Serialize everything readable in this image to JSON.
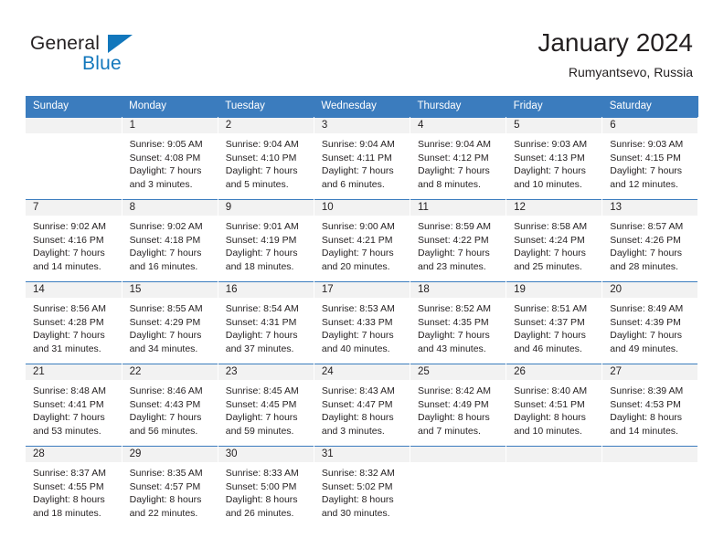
{
  "brand": {
    "name_part1": "General",
    "name_part2": "Blue"
  },
  "header": {
    "title": "January 2024",
    "subtitle": "Rumyantsevo, Russia"
  },
  "colors": {
    "header_blue": "#3b7cbe",
    "brand_blue": "#1277bc",
    "daynum_band": "#f2f2f2",
    "text": "#231f20"
  },
  "calendar": {
    "weekday_headers": [
      "Sunday",
      "Monday",
      "Tuesday",
      "Wednesday",
      "Thursday",
      "Friday",
      "Saturday"
    ],
    "weeks": [
      [
        {
          "day": "",
          "sunrise": "",
          "sunset": "",
          "daylight_line1": "",
          "daylight_line2": ""
        },
        {
          "day": "1",
          "sunrise": "Sunrise: 9:05 AM",
          "sunset": "Sunset: 4:08 PM",
          "daylight_line1": "Daylight: 7 hours",
          "daylight_line2": "and 3 minutes."
        },
        {
          "day": "2",
          "sunrise": "Sunrise: 9:04 AM",
          "sunset": "Sunset: 4:10 PM",
          "daylight_line1": "Daylight: 7 hours",
          "daylight_line2": "and 5 minutes."
        },
        {
          "day": "3",
          "sunrise": "Sunrise: 9:04 AM",
          "sunset": "Sunset: 4:11 PM",
          "daylight_line1": "Daylight: 7 hours",
          "daylight_line2": "and 6 minutes."
        },
        {
          "day": "4",
          "sunrise": "Sunrise: 9:04 AM",
          "sunset": "Sunset: 4:12 PM",
          "daylight_line1": "Daylight: 7 hours",
          "daylight_line2": "and 8 minutes."
        },
        {
          "day": "5",
          "sunrise": "Sunrise: 9:03 AM",
          "sunset": "Sunset: 4:13 PM",
          "daylight_line1": "Daylight: 7 hours",
          "daylight_line2": "and 10 minutes."
        },
        {
          "day": "6",
          "sunrise": "Sunrise: 9:03 AM",
          "sunset": "Sunset: 4:15 PM",
          "daylight_line1": "Daylight: 7 hours",
          "daylight_line2": "and 12 minutes."
        }
      ],
      [
        {
          "day": "7",
          "sunrise": "Sunrise: 9:02 AM",
          "sunset": "Sunset: 4:16 PM",
          "daylight_line1": "Daylight: 7 hours",
          "daylight_line2": "and 14 minutes."
        },
        {
          "day": "8",
          "sunrise": "Sunrise: 9:02 AM",
          "sunset": "Sunset: 4:18 PM",
          "daylight_line1": "Daylight: 7 hours",
          "daylight_line2": "and 16 minutes."
        },
        {
          "day": "9",
          "sunrise": "Sunrise: 9:01 AM",
          "sunset": "Sunset: 4:19 PM",
          "daylight_line1": "Daylight: 7 hours",
          "daylight_line2": "and 18 minutes."
        },
        {
          "day": "10",
          "sunrise": "Sunrise: 9:00 AM",
          "sunset": "Sunset: 4:21 PM",
          "daylight_line1": "Daylight: 7 hours",
          "daylight_line2": "and 20 minutes."
        },
        {
          "day": "11",
          "sunrise": "Sunrise: 8:59 AM",
          "sunset": "Sunset: 4:22 PM",
          "daylight_line1": "Daylight: 7 hours",
          "daylight_line2": "and 23 minutes."
        },
        {
          "day": "12",
          "sunrise": "Sunrise: 8:58 AM",
          "sunset": "Sunset: 4:24 PM",
          "daylight_line1": "Daylight: 7 hours",
          "daylight_line2": "and 25 minutes."
        },
        {
          "day": "13",
          "sunrise": "Sunrise: 8:57 AM",
          "sunset": "Sunset: 4:26 PM",
          "daylight_line1": "Daylight: 7 hours",
          "daylight_line2": "and 28 minutes."
        }
      ],
      [
        {
          "day": "14",
          "sunrise": "Sunrise: 8:56 AM",
          "sunset": "Sunset: 4:28 PM",
          "daylight_line1": "Daylight: 7 hours",
          "daylight_line2": "and 31 minutes."
        },
        {
          "day": "15",
          "sunrise": "Sunrise: 8:55 AM",
          "sunset": "Sunset: 4:29 PM",
          "daylight_line1": "Daylight: 7 hours",
          "daylight_line2": "and 34 minutes."
        },
        {
          "day": "16",
          "sunrise": "Sunrise: 8:54 AM",
          "sunset": "Sunset: 4:31 PM",
          "daylight_line1": "Daylight: 7 hours",
          "daylight_line2": "and 37 minutes."
        },
        {
          "day": "17",
          "sunrise": "Sunrise: 8:53 AM",
          "sunset": "Sunset: 4:33 PM",
          "daylight_line1": "Daylight: 7 hours",
          "daylight_line2": "and 40 minutes."
        },
        {
          "day": "18",
          "sunrise": "Sunrise: 8:52 AM",
          "sunset": "Sunset: 4:35 PM",
          "daylight_line1": "Daylight: 7 hours",
          "daylight_line2": "and 43 minutes."
        },
        {
          "day": "19",
          "sunrise": "Sunrise: 8:51 AM",
          "sunset": "Sunset: 4:37 PM",
          "daylight_line1": "Daylight: 7 hours",
          "daylight_line2": "and 46 minutes."
        },
        {
          "day": "20",
          "sunrise": "Sunrise: 8:49 AM",
          "sunset": "Sunset: 4:39 PM",
          "daylight_line1": "Daylight: 7 hours",
          "daylight_line2": "and 49 minutes."
        }
      ],
      [
        {
          "day": "21",
          "sunrise": "Sunrise: 8:48 AM",
          "sunset": "Sunset: 4:41 PM",
          "daylight_line1": "Daylight: 7 hours",
          "daylight_line2": "and 53 minutes."
        },
        {
          "day": "22",
          "sunrise": "Sunrise: 8:46 AM",
          "sunset": "Sunset: 4:43 PM",
          "daylight_line1": "Daylight: 7 hours",
          "daylight_line2": "and 56 minutes."
        },
        {
          "day": "23",
          "sunrise": "Sunrise: 8:45 AM",
          "sunset": "Sunset: 4:45 PM",
          "daylight_line1": "Daylight: 7 hours",
          "daylight_line2": "and 59 minutes."
        },
        {
          "day": "24",
          "sunrise": "Sunrise: 8:43 AM",
          "sunset": "Sunset: 4:47 PM",
          "daylight_line1": "Daylight: 8 hours",
          "daylight_line2": "and 3 minutes."
        },
        {
          "day": "25",
          "sunrise": "Sunrise: 8:42 AM",
          "sunset": "Sunset: 4:49 PM",
          "daylight_line1": "Daylight: 8 hours",
          "daylight_line2": "and 7 minutes."
        },
        {
          "day": "26",
          "sunrise": "Sunrise: 8:40 AM",
          "sunset": "Sunset: 4:51 PM",
          "daylight_line1": "Daylight: 8 hours",
          "daylight_line2": "and 10 minutes."
        },
        {
          "day": "27",
          "sunrise": "Sunrise: 8:39 AM",
          "sunset": "Sunset: 4:53 PM",
          "daylight_line1": "Daylight: 8 hours",
          "daylight_line2": "and 14 minutes."
        }
      ],
      [
        {
          "day": "28",
          "sunrise": "Sunrise: 8:37 AM",
          "sunset": "Sunset: 4:55 PM",
          "daylight_line1": "Daylight: 8 hours",
          "daylight_line2": "and 18 minutes."
        },
        {
          "day": "29",
          "sunrise": "Sunrise: 8:35 AM",
          "sunset": "Sunset: 4:57 PM",
          "daylight_line1": "Daylight: 8 hours",
          "daylight_line2": "and 22 minutes."
        },
        {
          "day": "30",
          "sunrise": "Sunrise: 8:33 AM",
          "sunset": "Sunset: 5:00 PM",
          "daylight_line1": "Daylight: 8 hours",
          "daylight_line2": "and 26 minutes."
        },
        {
          "day": "31",
          "sunrise": "Sunrise: 8:32 AM",
          "sunset": "Sunset: 5:02 PM",
          "daylight_line1": "Daylight: 8 hours",
          "daylight_line2": "and 30 minutes."
        },
        {
          "day": "",
          "sunrise": "",
          "sunset": "",
          "daylight_line1": "",
          "daylight_line2": ""
        },
        {
          "day": "",
          "sunrise": "",
          "sunset": "",
          "daylight_line1": "",
          "daylight_line2": ""
        },
        {
          "day": "",
          "sunrise": "",
          "sunset": "",
          "daylight_line1": "",
          "daylight_line2": ""
        }
      ]
    ]
  }
}
